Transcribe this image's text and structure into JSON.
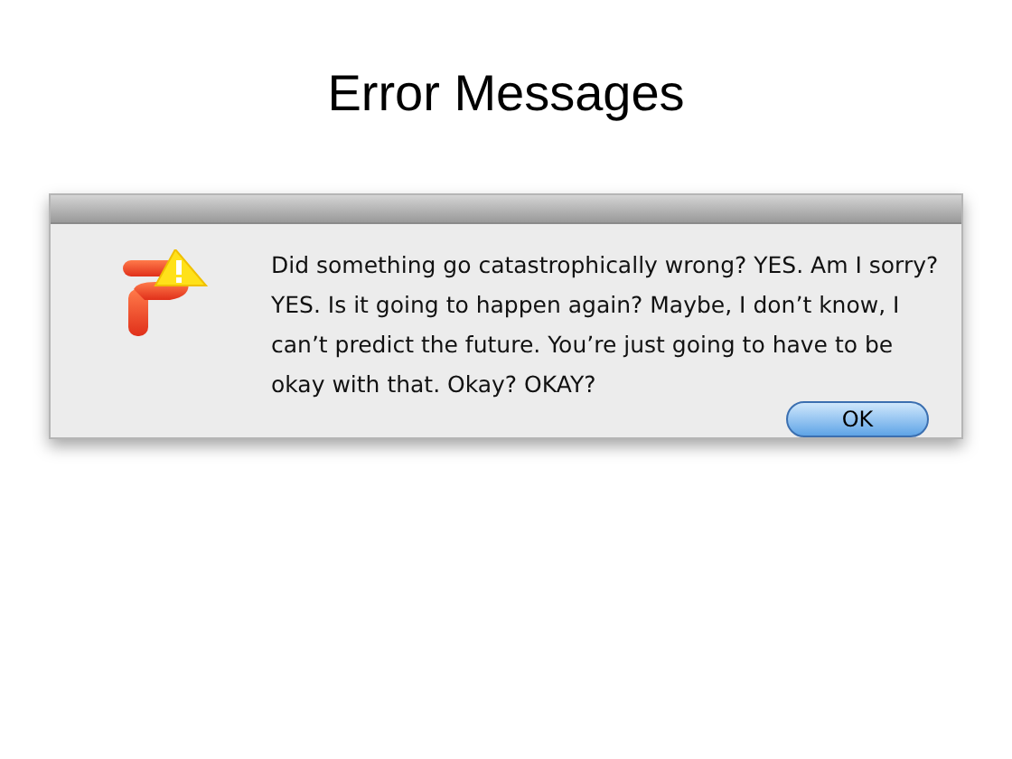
{
  "slide_title": "Error Messages",
  "dialog": {
    "message": "Did something go catastrophically wrong? YES. Am I sorry? YES. Is it going to happen again? Maybe, I don’t know, I can’t predict the future. You’re just going to have to be okay with that. Okay? OKAY?",
    "buttons": [
      {
        "label": "OK",
        "default": true
      }
    ]
  }
}
